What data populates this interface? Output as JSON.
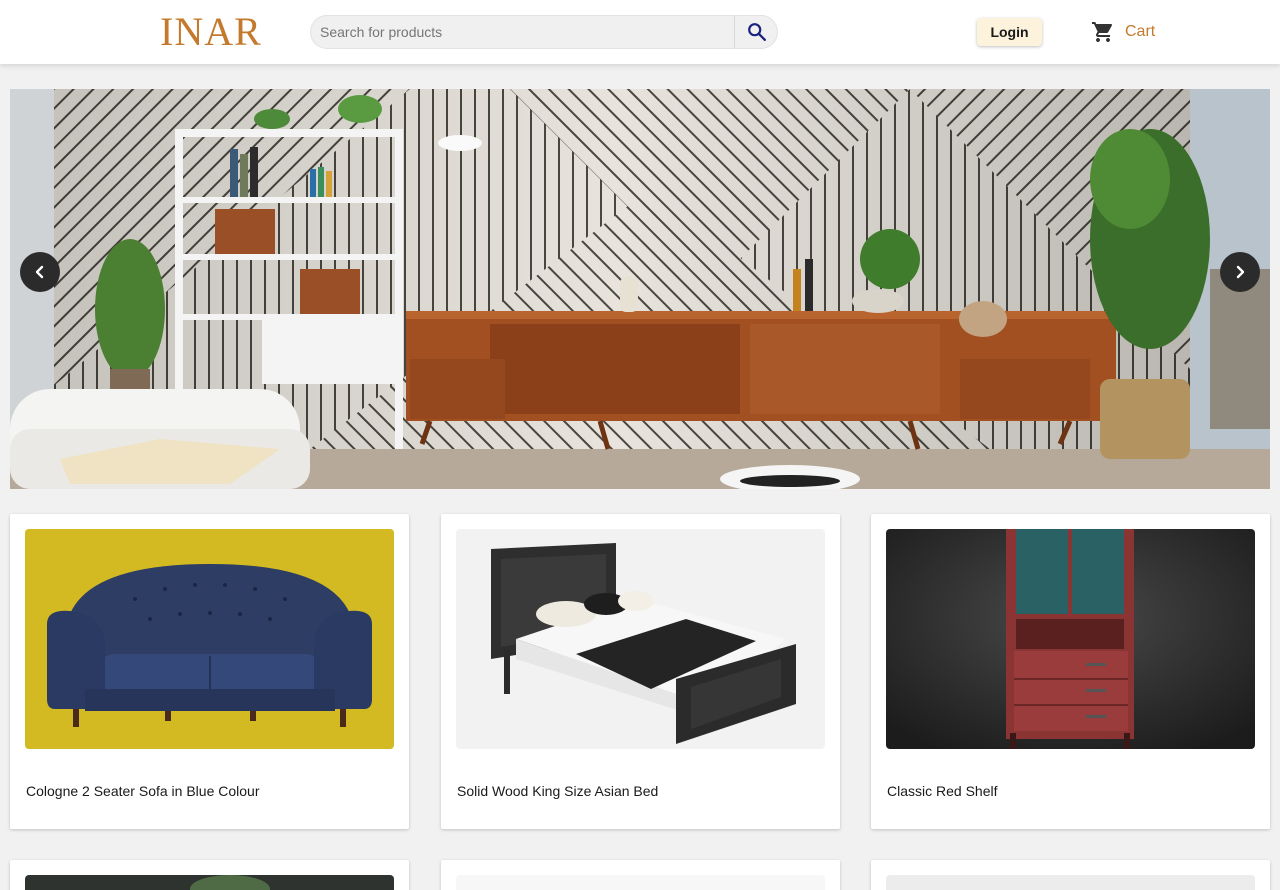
{
  "header": {
    "logo_text": "INAR",
    "search": {
      "placeholder": "Search for products",
      "value": ""
    },
    "login_label": "Login",
    "cart_label": "Cart"
  },
  "hero": {
    "prev_icon": "chevron-left-icon",
    "next_icon": "chevron-right-icon"
  },
  "products": [
    {
      "name": "Cologne 2 Seater Sofa in Blue Colour"
    },
    {
      "name": "Solid Wood King Size Asian Bed"
    },
    {
      "name": "Classic Red Shelf"
    }
  ],
  "colors": {
    "brand": "#c47a2c",
    "login_bg": "#fdf3dd",
    "page_bg": "#f1f1f1"
  }
}
